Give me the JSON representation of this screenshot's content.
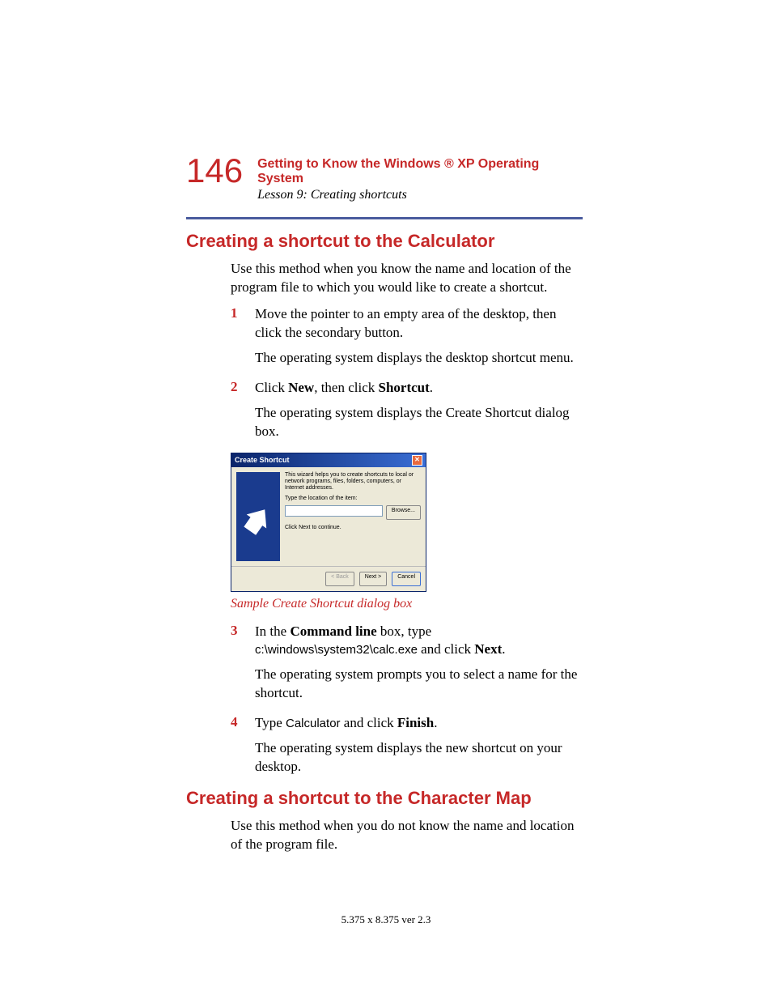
{
  "header": {
    "page_number": "146",
    "chapter": "Getting to Know the Windows ® XP Operating System",
    "lesson": "Lesson 9: Creating shortcuts"
  },
  "section1": {
    "heading": "Creating a shortcut to the Calculator",
    "intro": "Use this method when you know the name and location of the program file to which you would like to create a shortcut.",
    "steps": {
      "s1": {
        "num": "1",
        "text": "Move the pointer to an empty area of the desktop, then click the secondary button.",
        "result": "The operating system displays the desktop shortcut menu."
      },
      "s2": {
        "num": "2",
        "prefix": "Click ",
        "b1": "New",
        "mid": ", then click ",
        "b2": "Shortcut",
        "suffix": ".",
        "result": "The operating system displays the Create Shortcut dialog box."
      },
      "s3": {
        "num": "3",
        "prefix": "In the ",
        "b1": "Command line",
        "mid": " box, type ",
        "mono": "c:\\windows\\system32\\calc.exe",
        "mid2": " and click ",
        "b2": "Next",
        "suffix": ".",
        "result": "The operating system prompts you to select a name for the shortcut."
      },
      "s4": {
        "num": "4",
        "prefix": "Type ",
        "mono": "Calculator",
        "mid": " and click ",
        "b1": "Finish",
        "suffix": ".",
        "result": "The operating system displays the new shortcut on your desktop."
      }
    },
    "caption": "Sample Create Shortcut dialog box"
  },
  "dialog": {
    "title": "Create Shortcut",
    "desc": "This wizard helps you to create shortcuts to local or network programs, files, folders, computers, or Internet addresses.",
    "label": "Type the location of the item:",
    "browse": "Browse...",
    "hint": "Click Next to continue.",
    "back": "< Back",
    "next": "Next >",
    "cancel": "Cancel"
  },
  "section2": {
    "heading": "Creating a shortcut to the Character Map",
    "intro": "Use this method when you do not know the name and location of the program file."
  },
  "footer": "5.375 x 8.375 ver 2.3"
}
